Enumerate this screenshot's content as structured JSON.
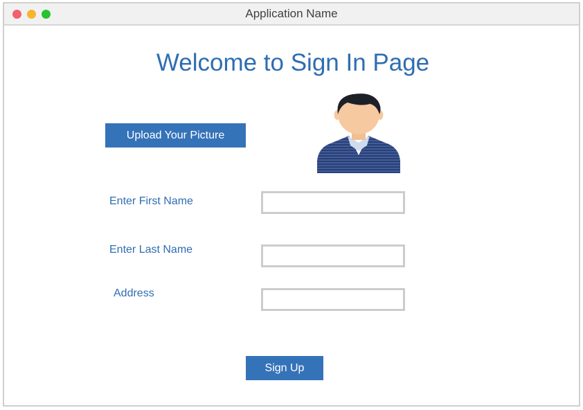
{
  "window": {
    "title": "Application Name",
    "controls": {
      "close_color": "#f0606e",
      "minimize_color": "#f7b52f",
      "maximize_color": "#27c232"
    }
  },
  "page": {
    "title": "Welcome to Sign In Page"
  },
  "upload": {
    "label": "Upload Your Picture"
  },
  "avatar": {
    "icon": "user-avatar-icon"
  },
  "form": {
    "first_name": {
      "label": "Enter First Name",
      "value": "",
      "placeholder": ""
    },
    "last_name": {
      "label": "Enter Last Name",
      "value": "",
      "placeholder": ""
    },
    "address": {
      "label": "Address",
      "value": "",
      "placeholder": ""
    }
  },
  "signup": {
    "label": "Sign Up"
  },
  "colors": {
    "accent": "#3573b9",
    "heading": "#2f6db1"
  }
}
